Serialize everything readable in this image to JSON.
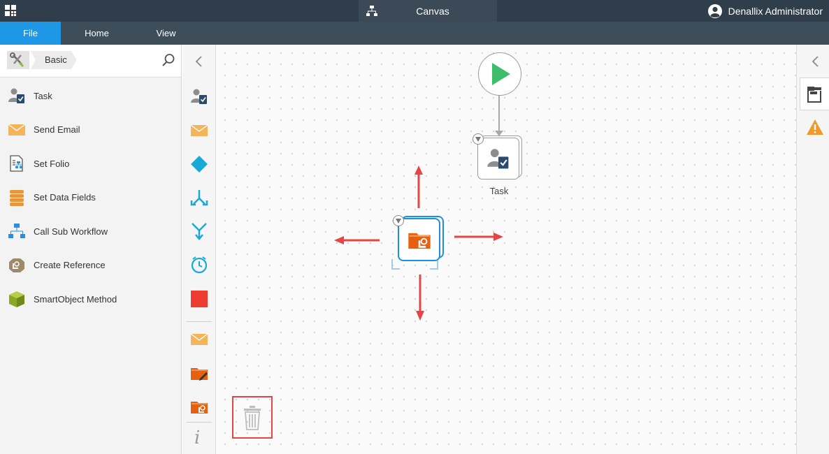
{
  "topbar": {
    "app_icon": "app-grid-icon",
    "tab_label": "Canvas",
    "tab_icon": "workflow-icon",
    "user_name": "Denallix Administrator",
    "user_icon": "user-avatar-icon"
  },
  "menu": {
    "file": "File",
    "home": "Home",
    "view": "View",
    "actions": [
      "undo-icon",
      "redo-icon",
      "save-icon"
    ]
  },
  "toolbox": {
    "breadcrumb_root_icon": "tools-icon",
    "breadcrumb": "Basic",
    "search_icon": "search-icon",
    "items": [
      {
        "label": "Task",
        "icon": "task-icon"
      },
      {
        "label": "Send Email",
        "icon": "email-icon"
      },
      {
        "label": "Set Folio",
        "icon": "set-folio-icon"
      },
      {
        "label": "Set Data Fields",
        "icon": "data-fields-icon"
      },
      {
        "label": "Call Sub Workflow",
        "icon": "sub-workflow-icon"
      },
      {
        "label": "Create Reference",
        "icon": "create-reference-icon"
      },
      {
        "label": "SmartObject Method",
        "icon": "smartobject-icon"
      }
    ]
  },
  "strip": {
    "icons": [
      "task-icon",
      "email-icon",
      "decision-icon",
      "split-icon",
      "merge-icon",
      "timer-icon",
      "end-icon",
      "email-template-icon",
      "folder-edit-icon",
      "folder-reference-icon",
      "info-icon"
    ],
    "info_glyph": "i"
  },
  "canvas": {
    "start_node": "start-icon",
    "task_node_label": "Task",
    "selected_node": "create-reference-icon",
    "trash_icon": "trash-icon"
  },
  "right_panel": {
    "icons": [
      "collapse-icon",
      "properties-icon",
      "warning-icon"
    ]
  },
  "colors": {
    "accent": "#1f97e7",
    "topbar": "#2f3e4a",
    "menubar": "#3d4d59",
    "start_green": "#3ebd6b",
    "arrow_red": "#e64545",
    "folder_orange": "#e6600f",
    "warning_orange": "#f09a2c"
  }
}
